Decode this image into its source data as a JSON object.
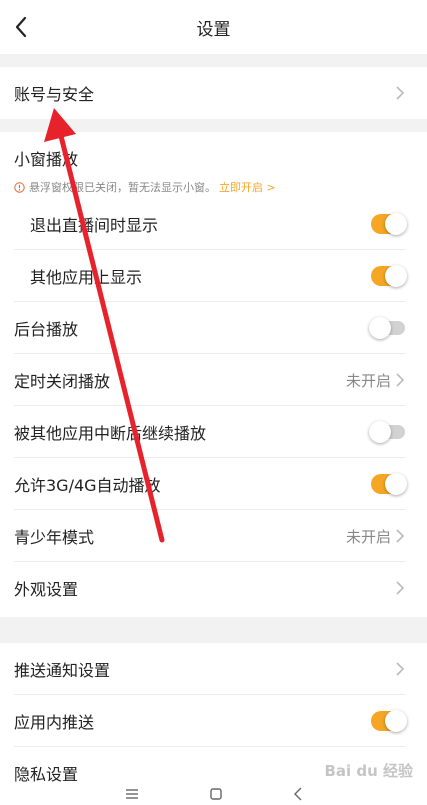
{
  "header": {
    "title": "设置"
  },
  "account": {
    "label": "账号与安全"
  },
  "mini_window": {
    "label": "小窗播放",
    "hint": "悬浮窗权限已关闭，暂无法显示小窗。",
    "hint_link": "立即开启 >"
  },
  "rows": {
    "exit_live": {
      "label": "退出直播间时显示",
      "state": "on"
    },
    "other_apps": {
      "label": "其他应用上显示",
      "state": "on"
    },
    "background": {
      "label": "后台播放",
      "state": "off"
    },
    "timer": {
      "label": "定时关闭播放",
      "value": "未开启"
    },
    "interrupt": {
      "label": "被其他应用中断后继续播放",
      "state": "off"
    },
    "mobile": {
      "label": "允许3G/4G自动播放",
      "state": "on"
    },
    "teen": {
      "label": "青少年模式",
      "value": "未开启"
    },
    "appearance": {
      "label": "外观设置"
    }
  },
  "push": {
    "notify": {
      "label": "推送通知设置"
    },
    "inapp": {
      "label": "应用内推送",
      "state": "on"
    },
    "privacy": {
      "label": "隐私设置"
    }
  },
  "watermark": "Bai du 经验",
  "colors": {
    "accent": "#f5a623",
    "annotation_arrow": "#e8222b"
  }
}
